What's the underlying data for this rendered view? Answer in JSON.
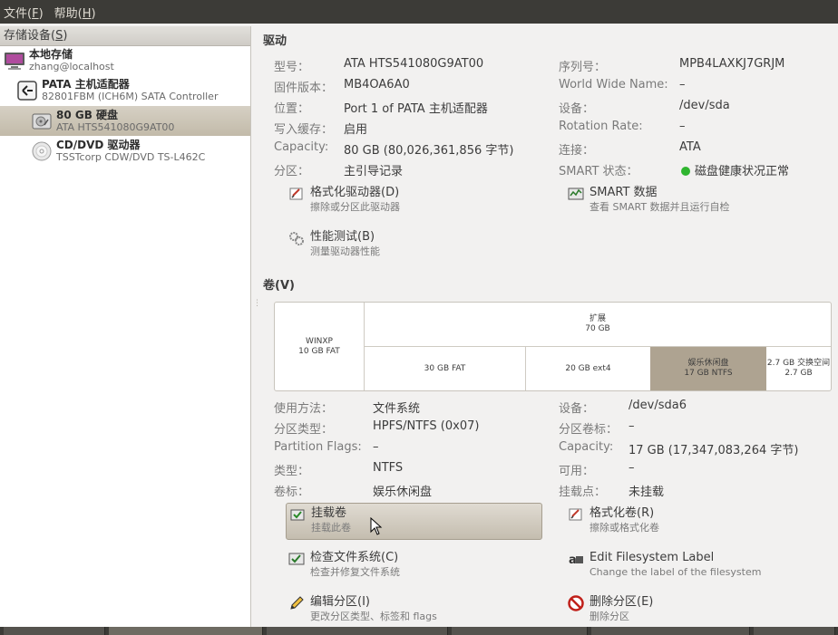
{
  "menubar": {
    "file_label": "文件(",
    "file_key": "F",
    "file_tail": ")",
    "help_label": "帮助(",
    "help_key": "H",
    "help_tail": ")"
  },
  "sidebar": {
    "header_label": "存储设备(",
    "header_key": "S",
    "header_tail": ")",
    "items": [
      {
        "title": "本地存储",
        "subtitle": "zhang@localhost",
        "icon": "computer-icon"
      },
      {
        "title": "PATA 主机适配器",
        "subtitle": "82801FBM (ICH6M) SATA Controller",
        "icon": "controller-icon"
      },
      {
        "title": "80 GB 硬盘",
        "subtitle": "ATA HTS541080G9AT00",
        "icon": "harddisk-icon"
      },
      {
        "title": "CD/DVD 驱动器",
        "subtitle": "TSSTcorp CDW/DVD TS-L462C",
        "icon": "optical-disc-icon"
      }
    ]
  },
  "drive": {
    "section_title": "驱动",
    "left": [
      {
        "label": "型号：",
        "value": "ATA HTS541080G9AT00"
      },
      {
        "label": "固件版本：",
        "value": "MB4OA6A0"
      },
      {
        "label": "位置：",
        "value": "Port 1 of PATA 主机适配器"
      },
      {
        "label": "写入缓存：",
        "value": "启用"
      },
      {
        "label": "Capacity:",
        "value": "80 GB (80,026,361,856 字节)"
      },
      {
        "label": "分区：",
        "value": "主引导记录"
      }
    ],
    "right": [
      {
        "label": "序列号：",
        "value": "MPB4LAXKJ7GRJM"
      },
      {
        "label": "World Wide Name:",
        "value": "–"
      },
      {
        "label": "设备：",
        "value": "/dev/sda"
      },
      {
        "label": "Rotation Rate:",
        "value": "–"
      },
      {
        "label": "连接：",
        "value": "ATA"
      },
      {
        "label": "SMART 状态：",
        "value": "磁盘健康状况正常",
        "status_color": "#2fb52f"
      }
    ],
    "actions": {
      "format": {
        "title": "格式化驱动器(D)",
        "desc": "擦除或分区此驱动器"
      },
      "smart": {
        "title": "SMART 数据",
        "desc": "查看 SMART 数据并且运行自检"
      },
      "benchmark": {
        "title": "性能测试(B)",
        "desc": "测量驱动器性能"
      }
    }
  },
  "volumes": {
    "section_title": "卷(V)",
    "map": {
      "winxp": {
        "name": "WINXP",
        "size": "10 GB FAT"
      },
      "extended": {
        "name": "扩展",
        "size": "70 GB"
      },
      "fat30": {
        "size": "30 GB FAT"
      },
      "ext4": {
        "size": "20 GB ext4"
      },
      "ntfs": {
        "name": "娱乐休闲盘",
        "size": "17 GB NTFS"
      },
      "swap": {
        "name": "2.7 GB 交换空间",
        "size": "2.7 GB"
      }
    },
    "left": [
      {
        "label": "使用方法：",
        "value": "文件系统"
      },
      {
        "label": "分区类型：",
        "value": "HPFS/NTFS (0x07)"
      },
      {
        "label": "Partition Flags:",
        "value": "–"
      },
      {
        "label": "类型：",
        "value": "NTFS"
      },
      {
        "label": "卷标：",
        "value": "娱乐休闲盘"
      }
    ],
    "right": [
      {
        "label": "设备：",
        "value": "/dev/sda6"
      },
      {
        "label": "分区卷标：",
        "value": "–"
      },
      {
        "label": "Capacity:",
        "value": "17 GB (17,347,083,264 字节)"
      },
      {
        "label": "可用：",
        "value": "–"
      },
      {
        "label": "挂载点：",
        "value": "未挂载"
      }
    ],
    "actions": {
      "mount": {
        "title": "挂载卷",
        "desc": "挂载此卷"
      },
      "format": {
        "title": "格式化卷(R)",
        "desc": "擦除或格式化卷"
      },
      "check": {
        "title": "检查文件系统(C)",
        "desc": "检查并修复文件系统"
      },
      "label": {
        "title": "Edit Filesystem Label",
        "desc": "Change the label of the filesystem"
      },
      "edit": {
        "title": "编辑分区(I)",
        "desc": "更改分区类型、标签和 flags"
      },
      "delete": {
        "title": "删除分区(E)",
        "desc": "删除分区"
      }
    }
  },
  "colors": {
    "menubar_bg": "#3c3b37",
    "selection_bg": "#c2baa9",
    "selected_volume": "#aea391",
    "healthy": "#2fb52f"
  }
}
